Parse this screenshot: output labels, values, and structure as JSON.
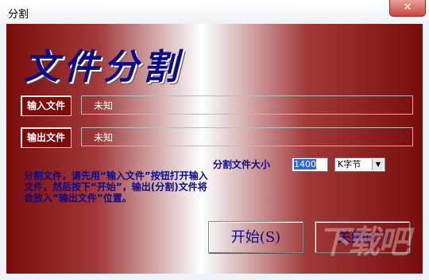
{
  "window": {
    "title": "分割",
    "close_label": "✕"
  },
  "headline": "文件分割",
  "input_file": {
    "label": "输入文件",
    "value": "未知"
  },
  "output_file": {
    "label": "输出文件",
    "value": "未知"
  },
  "split_size": {
    "label": "分割文件大小",
    "value": "1400",
    "unit": "K字节"
  },
  "instructions": "分割文件，请先用“输入文件”按钮打开输入文件，然后按下“开始”，输出(分割)文件将会放入“输出文件”位置。",
  "buttons": {
    "start": "开始(S)",
    "close": "关闭(C)"
  },
  "watermark": "下载吧"
}
